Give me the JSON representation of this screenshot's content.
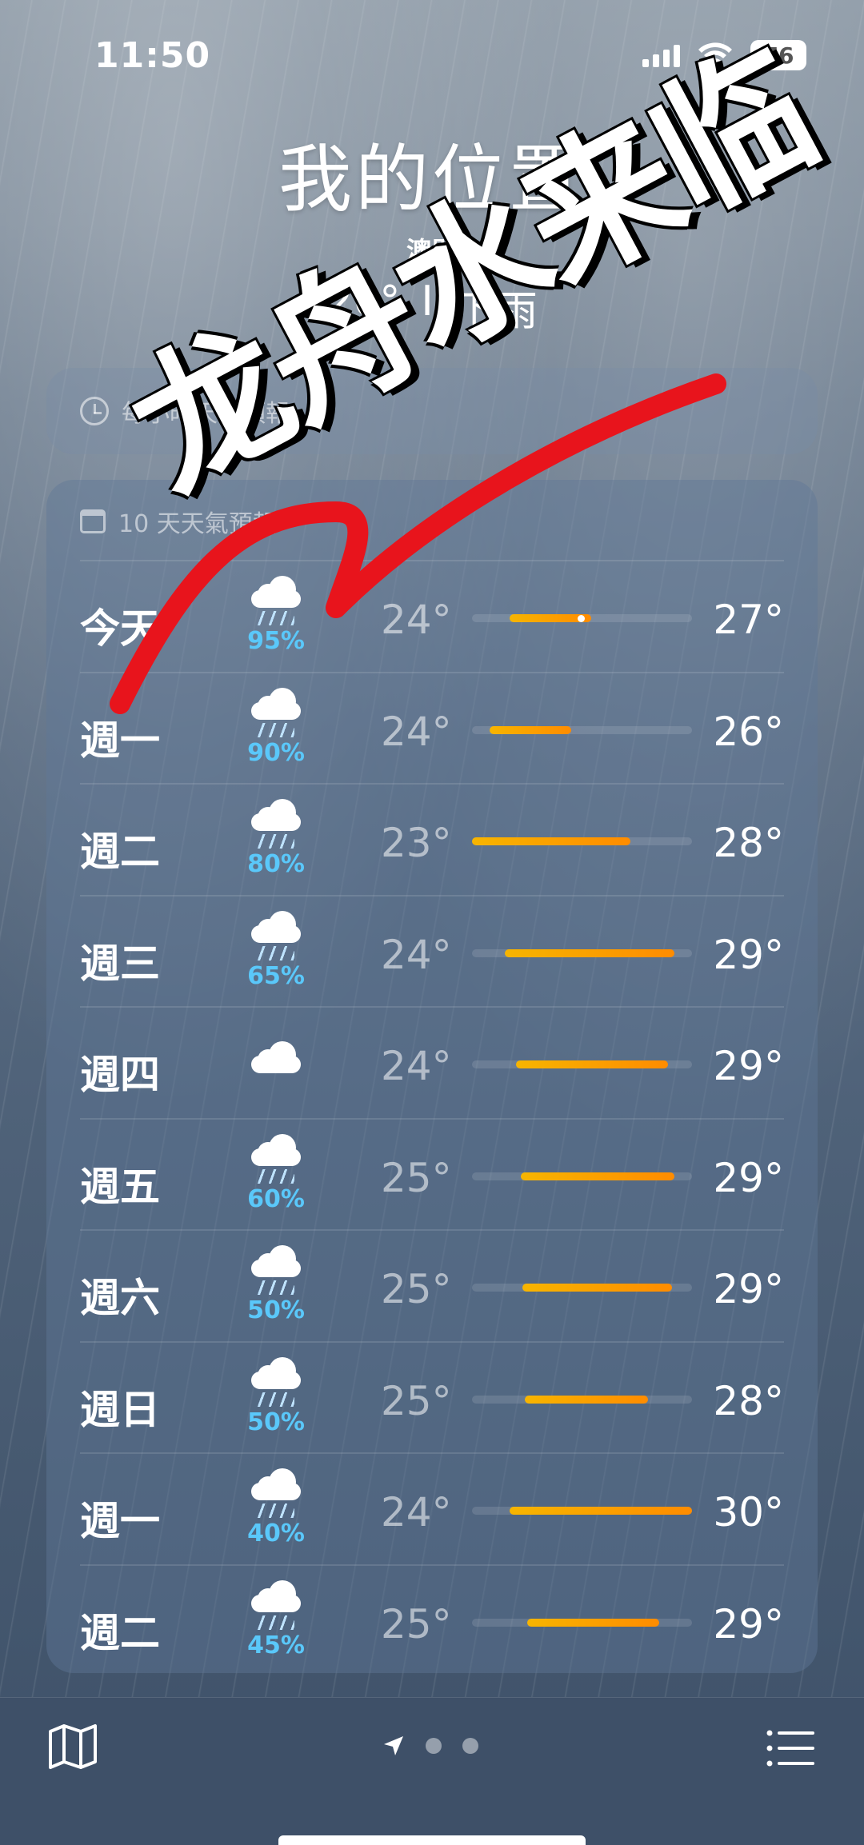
{
  "status_bar": {
    "time": "11:50",
    "battery": "76"
  },
  "header": {
    "location": "我的位置",
    "city": "澳門",
    "temp": "26°",
    "separator": "I",
    "condition": "下雨"
  },
  "hourly": {
    "label": "每小時天氣預報"
  },
  "daily": {
    "label": "10 天天氣預報",
    "days": [
      {
        "day": "今天",
        "pct": "95%",
        "icon": "rain-cloud-icon",
        "low": "24°",
        "high": "27°",
        "bar_start": 0.17,
        "bar_end": 0.54,
        "now": 0.48
      },
      {
        "day": "週一",
        "pct": "90%",
        "icon": "heavy-rain-cloud-icon",
        "low": "24°",
        "high": "26°",
        "bar_start": 0.08,
        "bar_end": 0.45
      },
      {
        "day": "週二",
        "pct": "80%",
        "icon": "rain-cloud-icon",
        "low": "23°",
        "high": "28°",
        "bar_start": 0.0,
        "bar_end": 0.72
      },
      {
        "day": "週三",
        "pct": "65%",
        "icon": "rain-cloud-icon",
        "low": "24°",
        "high": "29°",
        "bar_start": 0.15,
        "bar_end": 0.92
      },
      {
        "day": "週四",
        "pct": "",
        "icon": "cloud-icon",
        "low": "24°",
        "high": "29°",
        "bar_start": 0.2,
        "bar_end": 0.89
      },
      {
        "day": "週五",
        "pct": "60%",
        "icon": "rain-cloud-icon",
        "low": "25°",
        "high": "29°",
        "bar_start": 0.22,
        "bar_end": 0.92
      },
      {
        "day": "週六",
        "pct": "50%",
        "icon": "rain-cloud-icon",
        "low": "25°",
        "high": "29°",
        "bar_start": 0.23,
        "bar_end": 0.91
      },
      {
        "day": "週日",
        "pct": "50%",
        "icon": "rain-cloud-icon",
        "low": "25°",
        "high": "28°",
        "bar_start": 0.24,
        "bar_end": 0.8
      },
      {
        "day": "週一",
        "pct": "40%",
        "icon": "rain-cloud-icon",
        "low": "24°",
        "high": "30°",
        "bar_start": 0.17,
        "bar_end": 1.0
      },
      {
        "day": "週二",
        "pct": "45%",
        "icon": "rain-cloud-icon",
        "low": "25°",
        "high": "29°",
        "bar_start": 0.25,
        "bar_end": 0.85
      }
    ]
  },
  "overlay": {
    "sticker_text": "龙舟水来临",
    "arrow_color": "#e8141c"
  },
  "colors": {
    "bar_start": "#f7b500",
    "bar_end": "#ff8c00",
    "precip": "#5ac8fa"
  },
  "toolbar": {
    "left_icon": "map-icon",
    "right_icon": "list-icon",
    "location_icon": "location-arrow-icon"
  }
}
